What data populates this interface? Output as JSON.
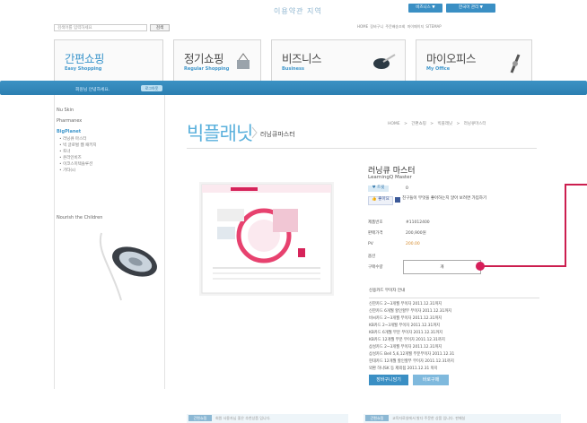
{
  "header": {
    "logo": "이용약관 지역",
    "top_buttons": [
      "비즈니스 ▼",
      "한국어 관리 ▼"
    ],
    "search_placeholder": "검색어를 입력하세요",
    "search_button": "검색",
    "util_links": "HOME 장바구니 주문배송조회 마이페이지 SITEMAP"
  },
  "tiles": [
    {
      "title": "간편쇼핑",
      "subtitle": "Easy Shopping"
    },
    {
      "title": "정기쇼핑",
      "subtitle": "Regular Shopping"
    },
    {
      "title": "비즈니스",
      "subtitle": "Business"
    },
    {
      "title": "마이오피스",
      "subtitle": "My Office"
    }
  ],
  "band": {
    "text": "회원님 안녕하세요.",
    "button": "로그아웃"
  },
  "sidebar": {
    "items": [
      "Nu Skin",
      "Pharmanex",
      "BigPlanet"
    ],
    "sub_items": [
      "• 러닝큐 마스터",
      "• 빅 글로벌 웹 패키지",
      "• 토너",
      "• 온라인비즈",
      "• 이코스미텍솔루션",
      "• 기타(s)"
    ],
    "promo": "Nourish the Children"
  },
  "main": {
    "title": "빅플래닛",
    "subtitle": "러닝큐마스터",
    "breadcrumb": "HOME > 간편쇼핑 > 빅플래닛 > 러닝큐마스터"
  },
  "product": {
    "name": "러닝큐 마스터",
    "name_en": "LearningQ Master",
    "tweet_label": "♥ 트윗",
    "tweet_count": "0",
    "like_label": "👍 좋아요",
    "fb_text": "친구들이 무엇을 좋아하는지 알아 보려면 가입하기",
    "fields": [
      {
        "label": "제품번호",
        "value": "#11012400"
      },
      {
        "label": "판매가격",
        "value": "200,900원"
      },
      {
        "label": "PV",
        "value": "200.00"
      },
      {
        "label": "옵션",
        "value": ""
      },
      {
        "label": "구매수량",
        "value": ""
      }
    ],
    "qty_unit": "개"
  },
  "card_section": {
    "heading": "신용카드 무이자 안내",
    "lines": [
      "신한카드 2~3개월 무이자 2011.12.31까지",
      "신한카드 6개월 할인할부 무이자 2011.12.31까지",
      "비씨카드 2~3개월 무이자 2011.12.31까지",
      "KB카드 2~3개월 무이자 2011.12.31까지",
      "KB카드 6개월 부분 무이자 2011.12.31까지",
      "KB카드 12개월 부분 무이자 2011.12.31까지",
      "삼성카드 2~3개월 무이자 2011.12.31까지",
      "삼성카드 Bell 5,6,12개월 부분무이자 2011.12.31",
      "현대카드 12개월 할인할부 무이자 2011.12.31까지",
      "외환 하나SK 등 제외됨 2011.12.31 까지"
    ]
  },
  "actions": {
    "cart": "장바구니담기",
    "buy": "바로구매"
  },
  "footer": {
    "tag1": "간편쇼핑",
    "text1": "회원 사용자님 좋은 추천상품 입니다.",
    "tag2": "간편쇼핑",
    "text2": "교육자료실에서 발다 주문한 상품 입니다. 판매실"
  },
  "colors": {
    "accent": "#3a8fc4",
    "highlight": "#cc1e4f",
    "title": "#5ab0dc"
  }
}
